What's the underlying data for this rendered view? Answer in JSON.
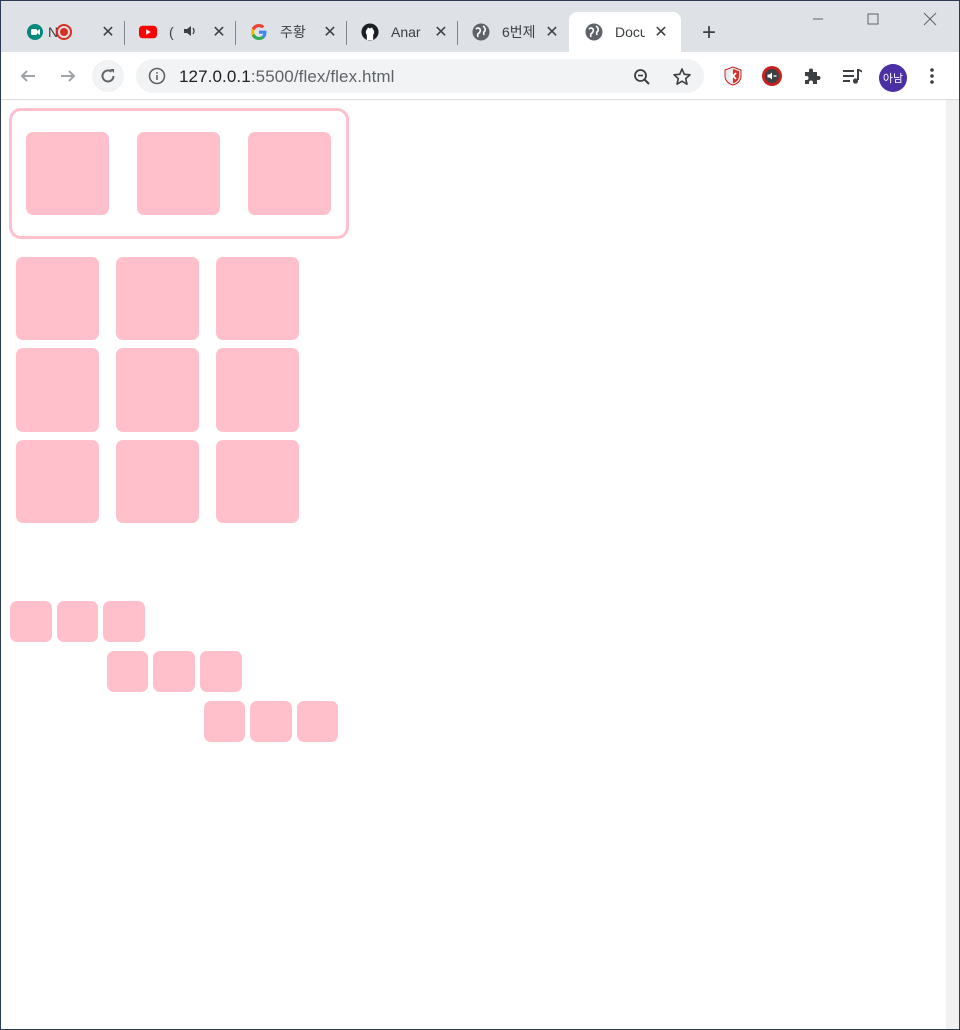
{
  "browser": {
    "tabs": [
      {
        "title": "N",
        "icon": "google-meet-icon",
        "extra": "recording-icon"
      },
      {
        "title": "(",
        "icon": "youtube-icon",
        "extra": "audio-icon"
      },
      {
        "title": "주황",
        "icon": "google-icon"
      },
      {
        "title": "Anar",
        "icon": "github-icon"
      },
      {
        "title": "6번제",
        "icon": "globe-icon"
      },
      {
        "title": "Docu",
        "icon": "globe-icon",
        "active": true
      }
    ],
    "close_glyph": "✕",
    "new_tab_glyph": "+",
    "url_host": "127.0.0.1",
    "url_rest": ":5500/flex/flex.html",
    "avatar_label": "아남"
  },
  "page": {
    "box_color": "#ffc0cb",
    "containers": [
      {
        "name": "bordered-row",
        "count": 3
      },
      {
        "name": "grid",
        "count": 9
      },
      {
        "name": "staircase",
        "count": 9
      }
    ]
  }
}
